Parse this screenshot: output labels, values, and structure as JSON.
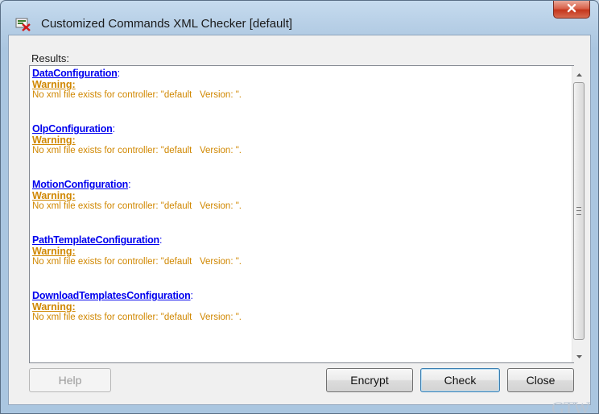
{
  "window": {
    "title": "Customized Commands XML Checker [default]"
  },
  "results": {
    "label": "Results:",
    "entries": [
      {
        "name": "DataConfiguration",
        "colon": ":",
        "warning": "Warning:",
        "message": "No xml file exists for controller: \"default   Version: \"."
      },
      {
        "name": "OlpConfiguration",
        "colon": ":",
        "warning": "Warning:",
        "message": "No xml file exists for controller: \"default   Version: \"."
      },
      {
        "name": "MotionConfiguration",
        "colon": ":",
        "warning": "Warning:",
        "message": "No xml file exists for controller: \"default   Version: \"."
      },
      {
        "name": "PathTemplateConfiguration",
        "colon": ":",
        "warning": "Warning:",
        "message": "No xml file exists for controller: \"default   Version: \"."
      },
      {
        "name": "DownloadTemplatesConfiguration",
        "colon": ":",
        "warning": "Warning:",
        "message": "No xml file exists for controller: \"default   Version: \"."
      }
    ]
  },
  "buttons": {
    "help": "Help",
    "encrypt": "Encrypt",
    "check": "Check",
    "close": "Close"
  },
  "icons": {
    "app": "xml-checker-icon",
    "close": "close-icon",
    "scroll_up": "arrow-up-icon",
    "scroll_down": "arrow-down-icon"
  },
  "colors": {
    "link": "#0000ee",
    "warning": "#d08700",
    "close_button": "#c4361c"
  },
  "watermark": "GTW"
}
